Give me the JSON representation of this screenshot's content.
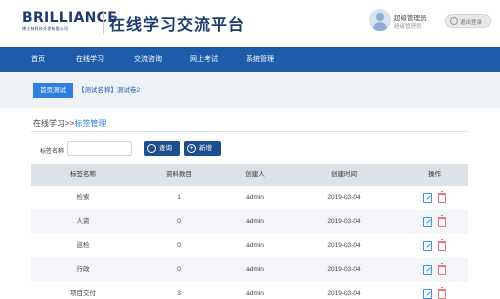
{
  "header": {
    "logo_text": "BRILLIANCE",
    "logo_subtext": "博士林科技开发有限公司",
    "site_title": "在线学习交流平台",
    "user_name": "超级管理员",
    "user_role": "超级管理员",
    "logout_label": "退出登录"
  },
  "nav": {
    "items": [
      {
        "label": "首页"
      },
      {
        "label": "在线学习"
      },
      {
        "label": "交流咨询"
      },
      {
        "label": "网上考试"
      },
      {
        "label": "系统管理"
      }
    ]
  },
  "tabs": {
    "active": "首页测试",
    "second": "【测试名称】测试卷2"
  },
  "breadcrumb": {
    "parent": "在线学习>>",
    "current": "标签管理"
  },
  "search": {
    "label": "标签名称",
    "value": "",
    "placeholder": "",
    "query_label": "查询",
    "add_label": "新增"
  },
  "table": {
    "columns": [
      "标签名称",
      "资料数目",
      "创建人",
      "创建时间",
      "操作"
    ],
    "rows": [
      {
        "name": "检索",
        "count": "1",
        "creator": "admin",
        "date": "2019-03-04"
      },
      {
        "name": "人资",
        "count": "0",
        "creator": "admin",
        "date": "2019-03-04"
      },
      {
        "name": "巡检",
        "count": "0",
        "creator": "admin",
        "date": "2019-03-04"
      },
      {
        "name": "行政",
        "count": "0",
        "creator": "admin",
        "date": "2019-03-04"
      },
      {
        "name": "项目交付",
        "count": "3",
        "creator": "admin",
        "date": "2019-03-04"
      }
    ]
  },
  "colors": {
    "nav_bg": "#1d5cab",
    "accent": "#2f7fe0",
    "button_bg": "#1d4f8f",
    "header_bg": "#dde2e8",
    "edit_icon": "#3b8ee6",
    "delete_icon": "#e07a7a"
  },
  "icons": {
    "avatar": "user-avatar-icon",
    "logout": "power-icon",
    "query": "search-icon",
    "add": "plus-icon",
    "edit": "edit-icon",
    "delete": "trash-icon"
  }
}
